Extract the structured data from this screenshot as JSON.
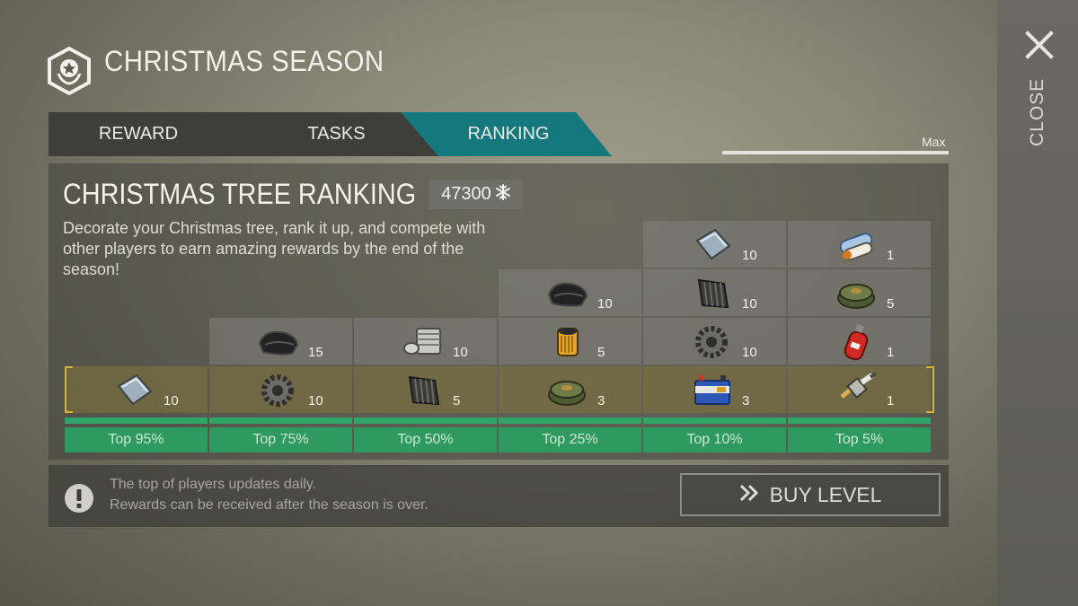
{
  "header": {
    "title": "CHRISTMAS SEASON",
    "icon": "season-star-badge-icon"
  },
  "close": {
    "label": "CLOSE",
    "icon": "close-icon"
  },
  "tabs": [
    {
      "label": "REWARD",
      "active": false
    },
    {
      "label": "TASKS",
      "active": false
    },
    {
      "label": "RANKING",
      "active": true
    }
  ],
  "progress": {
    "label": "Max",
    "fraction": 1.0
  },
  "ranking": {
    "title": "CHRISTMAS TREE RANKING",
    "score": "47300",
    "score_icon": "snowflake-icon",
    "description": "Decorate your Christmas tree, rank it up, and compete with other players to earn amazing rewards by the end of the season!"
  },
  "tiers": [
    {
      "label": "Top 95%",
      "rewards": [
        {
          "item": "steel-plate-icon",
          "qty": "10"
        }
      ]
    },
    {
      "label": "Top 75%",
      "rewards": [
        {
          "item": "gear-icon",
          "qty": "10"
        },
        {
          "item": "rubber-sheet-icon",
          "qty": "15"
        }
      ]
    },
    {
      "label": "Top 50%",
      "rewards": [
        {
          "item": "corrugated-sheet-icon",
          "qty": "5"
        },
        {
          "item": "engine-cylinder-icon",
          "qty": "10"
        }
      ]
    },
    {
      "label": "Top 25%",
      "rewards": [
        {
          "item": "landmine-icon",
          "qty": "3"
        },
        {
          "item": "oil-filter-icon",
          "qty": "5"
        },
        {
          "item": "rubber-sheet-icon",
          "qty": "10"
        }
      ]
    },
    {
      "label": "Top 10%",
      "rewards": [
        {
          "item": "car-battery-icon",
          "qty": "3"
        },
        {
          "item": "gear-icon",
          "qty": "10"
        },
        {
          "item": "corrugated-sheet-icon",
          "qty": "10"
        },
        {
          "item": "steel-plate-icon",
          "qty": "10"
        }
      ]
    },
    {
      "label": "Top 5%",
      "rewards": [
        {
          "item": "spark-plug-icon",
          "qty": "1"
        },
        {
          "item": "gas-cylinder-icon",
          "qty": "1"
        },
        {
          "item": "landmine-icon",
          "qty": "5"
        },
        {
          "item": "blueprint-roll-icon",
          "qty": "1"
        }
      ]
    }
  ],
  "footer": {
    "note1": "The top of players updates daily.",
    "note2": "Rewards can be received after the season is over.",
    "button_label": "BUY LEVEL"
  },
  "colors": {
    "accent_teal": "#14787c",
    "tier_green": "#2f9a60",
    "bracket_gold": "#d8b233"
  }
}
